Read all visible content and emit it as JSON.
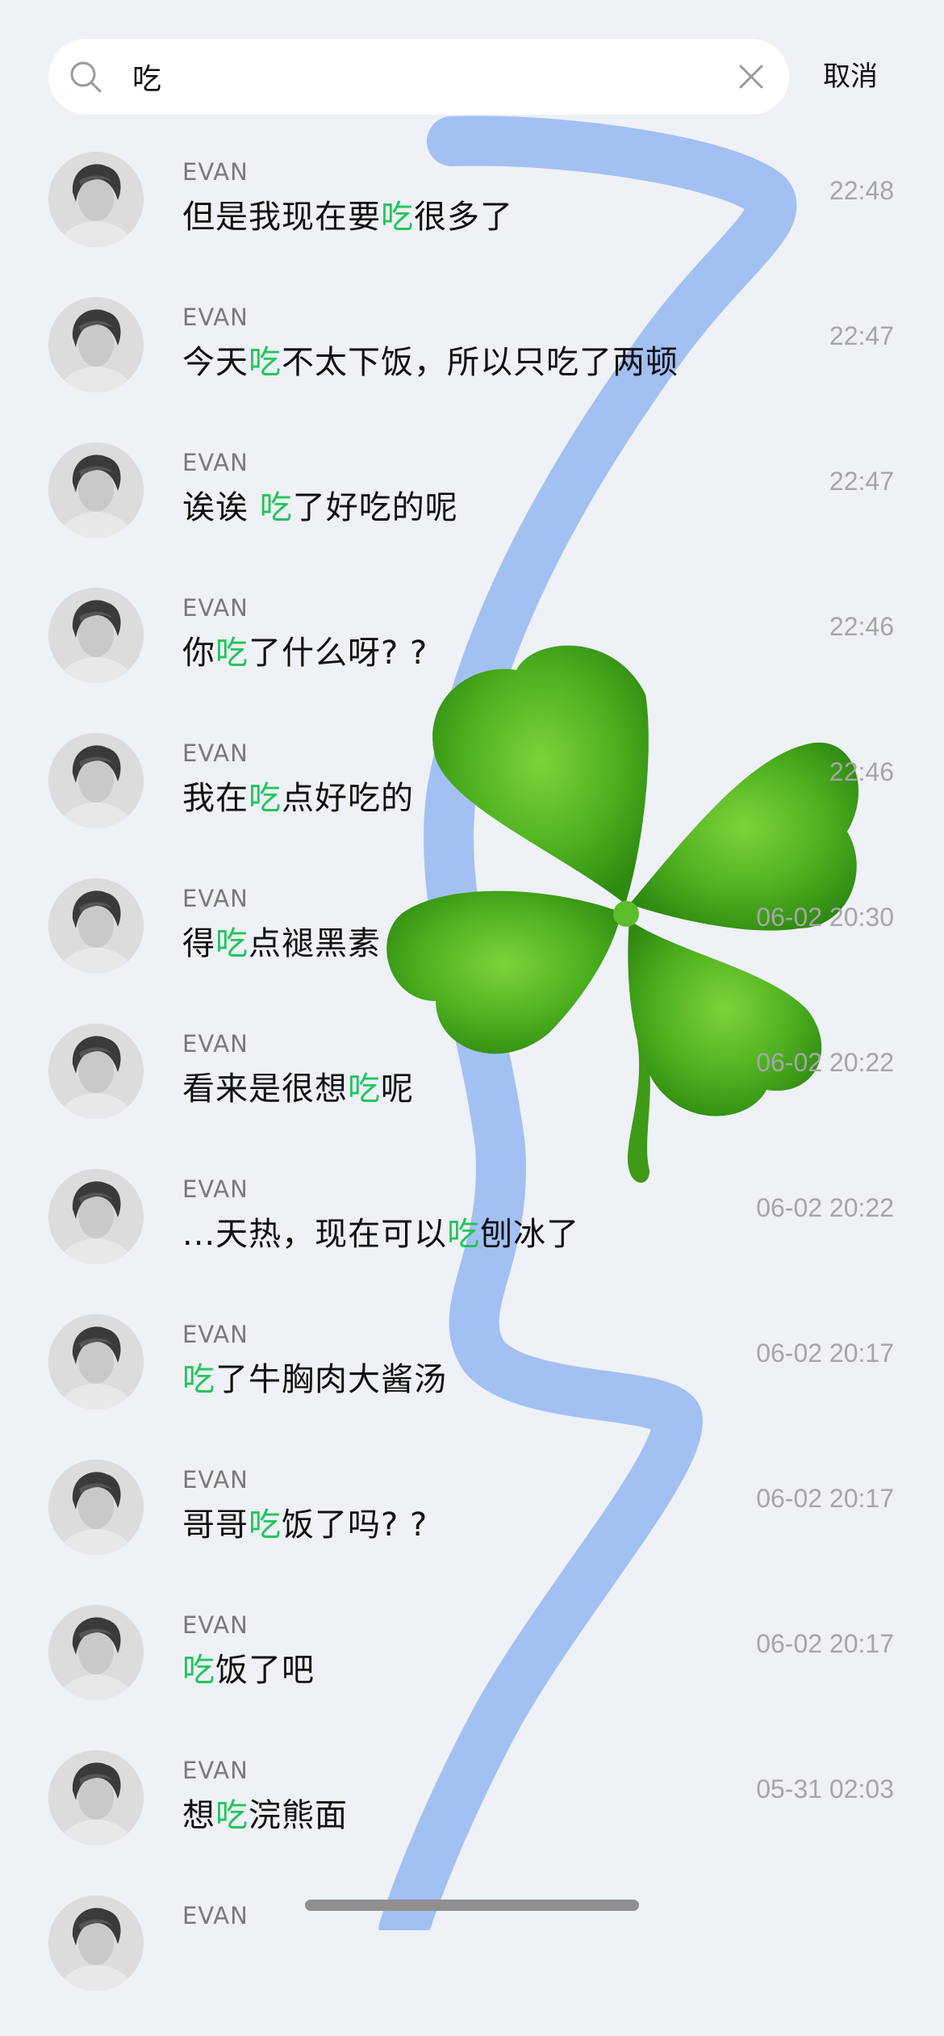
{
  "search": {
    "query": "吃",
    "cancel_label": "取消"
  },
  "results": [
    {
      "sender": "EVAN",
      "pre": "但是我现在要",
      "hl": "吃",
      "post": "很多了",
      "time": "22:48"
    },
    {
      "sender": "EVAN",
      "pre": "今天",
      "hl": "吃",
      "post": "不太下饭，所以只吃了两顿",
      "time": "22:47"
    },
    {
      "sender": "EVAN",
      "pre": "诶诶 ",
      "hl": "吃",
      "post": "了好吃的呢",
      "time": "22:47"
    },
    {
      "sender": "EVAN",
      "pre": "你",
      "hl": "吃",
      "post": "了什么呀? ?",
      "time": "22:46"
    },
    {
      "sender": "EVAN",
      "pre": "我在",
      "hl": "吃",
      "post": "点好吃的",
      "time": "22:46"
    },
    {
      "sender": "EVAN",
      "pre": "得",
      "hl": "吃",
      "post": "点褪黑素",
      "time": "06-02 20:30"
    },
    {
      "sender": "EVAN",
      "pre": "看来是很想",
      "hl": "吃",
      "post": "呢",
      "time": "06-02 20:22"
    },
    {
      "sender": "EVAN",
      "pre": "...天热，现在可以",
      "hl": "吃",
      "post": "刨冰了",
      "time": "06-02 20:22"
    },
    {
      "sender": "EVAN",
      "pre": "",
      "hl": "吃",
      "post": "了牛胸肉大酱汤",
      "time": "06-02 20:17"
    },
    {
      "sender": "EVAN",
      "pre": "哥哥",
      "hl": "吃",
      "post": "饭了吗? ?",
      "time": "06-02 20:17"
    },
    {
      "sender": "EVAN",
      "pre": "",
      "hl": "吃",
      "post": "饭了吧",
      "time": "06-02 20:17"
    },
    {
      "sender": "EVAN",
      "pre": "想",
      "hl": "吃",
      "post": "浣熊面",
      "time": "05-31 02:03"
    },
    {
      "sender": "EVAN",
      "pre": "",
      "hl": "",
      "post": "",
      "time": ""
    }
  ],
  "colors": {
    "background": "#eef1f5",
    "highlight": "#22c55e",
    "stroke": "#a3c0f3",
    "clover": "#4caf1e"
  },
  "icons": {
    "search": "search-icon",
    "clear": "clear-icon",
    "avatar": "avatar-portrait",
    "decoration": "clover-sticker"
  }
}
